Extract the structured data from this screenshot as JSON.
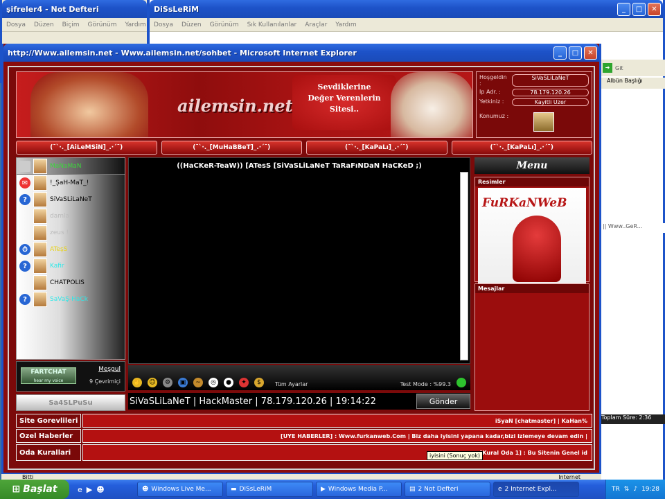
{
  "notepad": {
    "title": "şifreler4 - Not Defteri",
    "menu": [
      "Dosya",
      "Düzen",
      "Biçim",
      "Görünüm",
      "Yardım"
    ]
  },
  "explorer": {
    "title": "DiSsLeRiM",
    "menu": [
      "Dosya",
      "Düzen",
      "Görünüm",
      "Sık Kullanılanlar",
      "Araçlar",
      "Yardım"
    ],
    "go": "Git",
    "album_header": "Albün Başlığı",
    "item": "|| Www..GeR...",
    "total_time": "Toplam Süre: 2:36"
  },
  "ie": {
    "title": "http://Www.ailemsin.net - Www.ailemsin.net/sohbet - Microsoft Internet Explorer",
    "status_left": "Bitti",
    "status_right": "Internet"
  },
  "banner": {
    "logo": "ailemsin.net",
    "slogan": [
      "Sevdiklerine",
      "Değer Verenlerin",
      "Sitesi.."
    ]
  },
  "info": {
    "rows": [
      {
        "label": "Hoşgeldin :",
        "value": "SiVaSLiLaNeT"
      },
      {
        "label": "Ip Adr. :",
        "value": "78.179.120.26"
      },
      {
        "label": "Yetkiniz :",
        "value": "Kayitli Uzer"
      },
      {
        "label": "Konumuz :",
        "value": ""
      }
    ]
  },
  "nav": [
    "(¯`·._[AiLeMSiN]_.·´¯)",
    "(¯`·._[MuHaBBeT]_.·´¯)",
    "(¯`·._[KaPaLı]_.·´¯)",
    "(¯`·._[KaPaLı]_.·´¯)"
  ],
  "users": [
    {
      "name": "MaNaMaN",
      "color": "#3bd83b",
      "status": "",
      "stat_color": "#ccc"
    },
    {
      "name": "!_ŞaH-MaT_!",
      "color": "#111",
      "status": "✉",
      "stat_color": "#e33"
    },
    {
      "name": "SiVaSLiLaNeT",
      "color": "#111",
      "status": "?",
      "stat_color": "#2766d4"
    },
    {
      "name": "damla",
      "color": "#bbb",
      "status": "",
      "stat_color": "transparent"
    },
    {
      "name": "zeus !",
      "color": "#bbb",
      "status": "",
      "stat_color": "transparent"
    },
    {
      "name": "ATeşS",
      "color": "#e8d21a",
      "status": "⏱",
      "stat_color": "#2766d4"
    },
    {
      "name": "Kafir",
      "color": "#2ee8e8",
      "status": "?",
      "stat_color": "#2766d4"
    },
    {
      "name": "CHATPOLIS",
      "color": "#111",
      "status": "",
      "stat_color": "transparent"
    },
    {
      "name": "SaVaŞ-HaCk",
      "color": "#2ee8e8",
      "status": "?",
      "stat_color": "#2766d4"
    }
  ],
  "fartchat": {
    "logo": "FARTCHAT",
    "tagline": "hear my voice",
    "status": "Meşgul",
    "online": "9 Çevrimiçi"
  },
  "send_button": "Sa4SLPuSu",
  "chat": {
    "message": "((HaCKeR-TeaW)) [ATesS [SiVaSLiLaNeT TaRaFıNDaN HaCKeD ;)"
  },
  "toolbar": {
    "all_settings": "Tüm Ayarlar",
    "test_mode": "Test Mode : %99.3"
  },
  "input": {
    "value": "SiVaSLiLaNeT | HackMaster | 78.179.120.26 | 19:14:22",
    "button": "Gönder"
  },
  "right": {
    "menu": "Menu",
    "pictures": "Resimler",
    "picture_text": "FuRKaNWeB",
    "messages": "Mesajlar"
  },
  "bottom": [
    {
      "label": "Site Gorevlileri",
      "text": "iSyaN [chatmaster]  |  KaHan%"
    },
    {
      "label": "Ozel Haberler",
      "text": "[UYE HABERLER] : Www.furkanweb.Com | Biz daha iyisini yapana kadar,bizi izlemeye devam edin |"
    },
    {
      "label": "Oda Kurallari",
      "text": "[Kural Oda 1] : Bu Sitenin Genel id"
    }
  ],
  "tooltip": "iyisini (Sonuç yok)",
  "taskbar": {
    "start": "Başlat",
    "tasks": [
      "Windows Live Me...",
      "DiSsLeRiM",
      "Windows Media P...",
      "2 Not Defteri",
      "2 Internet Expl..."
    ],
    "lang": "TR",
    "clock": "19:28"
  },
  "colors": {
    "ie_bg": "#8a0c0c",
    "accent": "#b41111",
    "xp_blue": "#1c53c9"
  }
}
